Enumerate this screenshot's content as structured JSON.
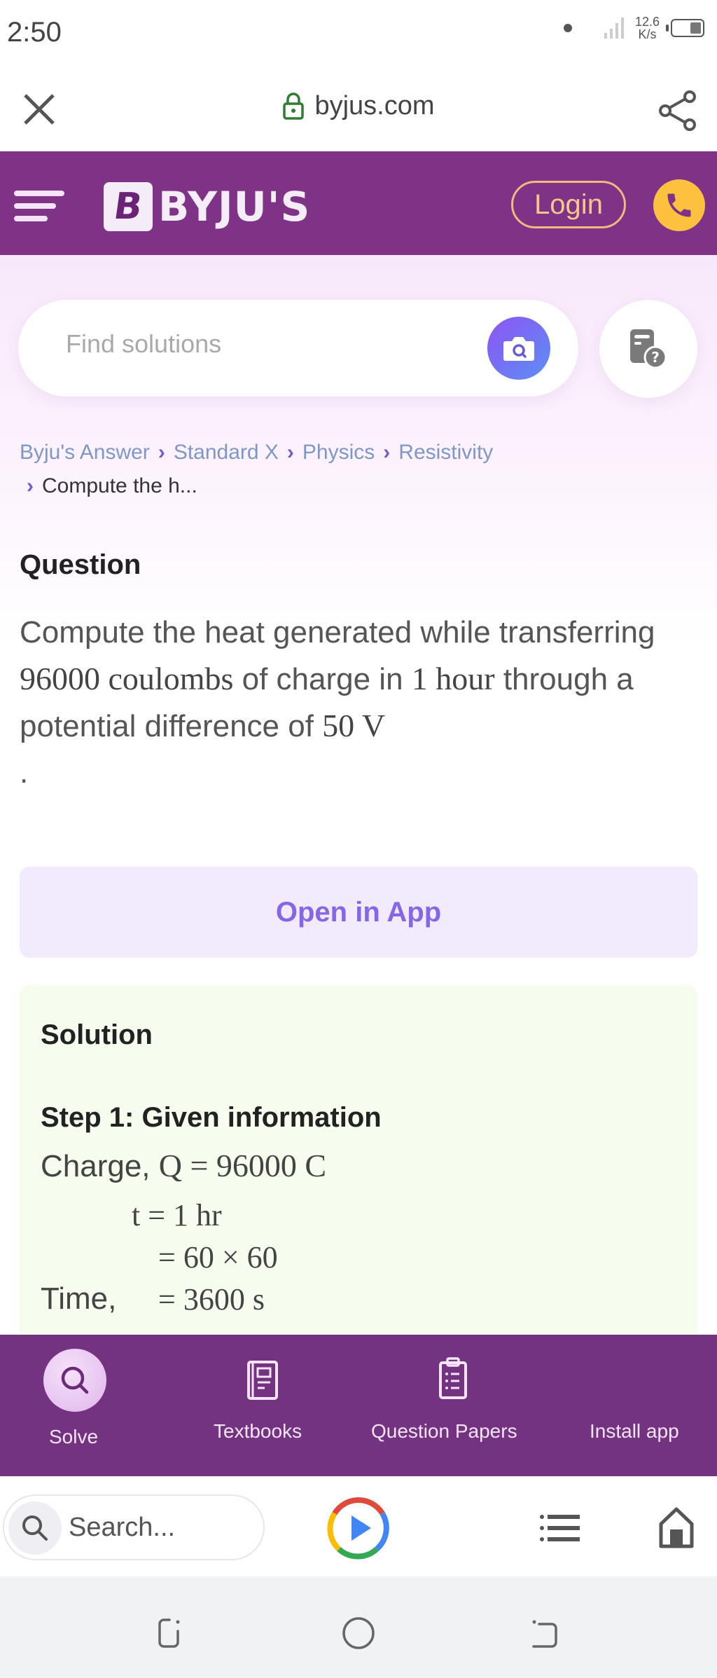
{
  "status_bar": {
    "time": "2:50",
    "net_speed_value": "12.6",
    "net_speed_unit": "K/s",
    "battery_level": 0.4
  },
  "url_bar": {
    "close_icon": "close-icon",
    "lock_icon": "lock-icon",
    "domain": "byjus.com",
    "share_icon": "share-icon",
    "lock_color": "#2e7d32"
  },
  "header": {
    "menu_icon": "hamburger-icon",
    "logo_mark": "B",
    "logo_text": "BYJU'S",
    "login_label": "Login",
    "call_icon": "phone-icon",
    "brand_color": "#7e3387",
    "accent_color": "#fcc13f"
  },
  "search": {
    "placeholder": "Find solutions",
    "value": "",
    "camera_icon": "camera-search-icon",
    "qa_icon": "question-paper-icon"
  },
  "breadcrumb": {
    "items": [
      "Byju's Answer",
      "Standard X",
      "Physics",
      "Resistivity"
    ],
    "current": "Compute the h...",
    "separator": "›"
  },
  "question": {
    "title": "Question",
    "text_1": "Compute the heat generated while transferring ",
    "math_charge": "96000  coulombs",
    "text_2": " of charge in ",
    "math_time": "1  hour",
    "text_3": " through a potential difference of ",
    "math_voltage": "50 V",
    "text_4": "."
  },
  "open_app": {
    "label": "Open in App"
  },
  "solution": {
    "title": "Solution",
    "step_title": "Step 1: Given information",
    "charge_label": "Charge, ",
    "charge_math": "Q = 96000 C",
    "time_line_1": "t = 1  hr",
    "time_line_2": "= 60 × 60",
    "time_label": "Time,",
    "time_line_3": "= 3600 s"
  },
  "site_nav": {
    "items": [
      {
        "label": "Solve",
        "icon": "search-icon",
        "active": true
      },
      {
        "label": "Textbooks",
        "icon": "textbook-icon",
        "active": false
      },
      {
        "label": "Question Papers",
        "icon": "clipboard-icon",
        "active": false
      },
      {
        "label": "Install app",
        "icon": "",
        "active": false
      }
    ]
  },
  "browser_bar": {
    "search_placeholder": "Search...",
    "search_icon": "search-icon",
    "play_icon": "play-icon",
    "tabs_icon": "list-icon",
    "home_icon": "home-icon"
  },
  "android_nav": {
    "recents_icon": "recents-icon",
    "home_icon": "home-circle-icon",
    "back_icon": "back-icon"
  }
}
